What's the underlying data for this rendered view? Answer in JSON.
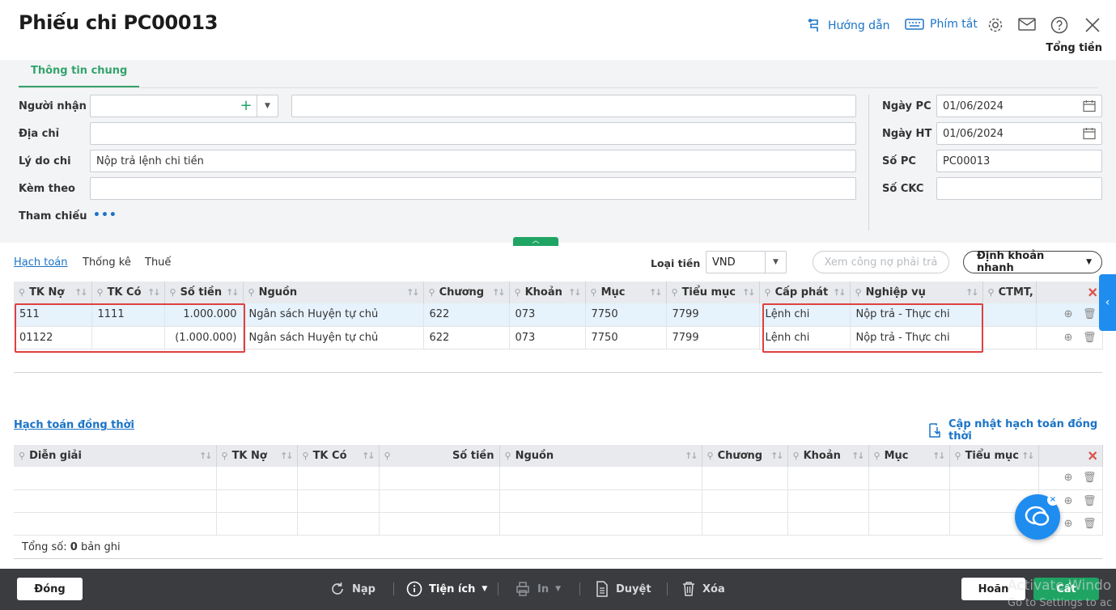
{
  "header": {
    "title": "Phiếu chi PC00013",
    "guide_label": "Hướng dẫn",
    "shortcut_label": "Phím tắt",
    "total_label": "Tổng tiền"
  },
  "tabs": {
    "general": "Thông tin chung"
  },
  "form": {
    "recipient_label": "Người nhận",
    "recipient_value": "",
    "recipient_name_value": "",
    "address_label": "Địa chỉ",
    "address_value": "",
    "reason_label": "Lý do chi",
    "reason_value": "Nộp trả lệnh chi tiền",
    "attach_label": "Kèm theo",
    "attach_value": "",
    "reference_label": "Tham chiếu",
    "reference_more": "•••",
    "date_pc_label": "Ngày PC",
    "date_pc_value": "01/06/2024",
    "date_ht_label": "Ngày HT",
    "date_ht_value": "01/06/2024",
    "so_pc_label": "Số PC",
    "so_pc_value": "PC00013",
    "so_ckc_label": "Số CKC",
    "so_ckc_value": ""
  },
  "subtabs": {
    "accounting": "Hạch toán",
    "stats": "Thống kê",
    "tax": "Thuế"
  },
  "currency": {
    "label": "Loại tiền",
    "value": "VND"
  },
  "buttons": {
    "view_debt": "Xem công nợ phải trả",
    "quick_entry": "Định khoản nhanh",
    "update_simul": "Cập nhật hạch toán đồng thời"
  },
  "accounting_table": {
    "columns": [
      "TK Nợ",
      "TK Có",
      "Số tiền",
      "Nguồn",
      "Chương",
      "Khoản",
      "Mục",
      "Tiểu mục",
      "Cấp phát",
      "Nghiệp vụ",
      "CTMT,"
    ],
    "rows": [
      {
        "tk_no": "511",
        "tk_co": "1111",
        "so_tien": "1.000.000",
        "nguon": "Ngân sách Huyện tự chủ",
        "chuong": "622",
        "khoan": "073",
        "muc": "7750",
        "tieu_muc": "7799",
        "cap_phat": "Lệnh chi",
        "nghiep_vu": "Nộp trả - Thực chi",
        "ctmt": ""
      },
      {
        "tk_no": "01122",
        "tk_co": "",
        "so_tien": "(1.000.000)",
        "nguon": "Ngân sách Huyện tự chủ",
        "chuong": "622",
        "khoan": "073",
        "muc": "7750",
        "tieu_muc": "7799",
        "cap_phat": "Lệnh chi",
        "nghiep_vu": "Nộp trả - Thực chi",
        "ctmt": ""
      }
    ]
  },
  "simul": {
    "title": "Hạch toán đồng thời",
    "columns": [
      "Diễn giải",
      "TK Nợ",
      "TK Có",
      "Số tiền",
      "Nguồn",
      "Chương",
      "Khoản",
      "Mục",
      "Tiểu mục"
    ],
    "total_prefix": "Tổng số:",
    "total_count": "0",
    "total_suffix": "bản ghi"
  },
  "footer": {
    "close": "Đóng",
    "reload": "Nạp",
    "utility": "Tiện ích",
    "print": "In",
    "approve": "Duyệt",
    "delete": "Xóa",
    "cancel": "Hoãn",
    "save": "Cất"
  },
  "watermark": {
    "line1": "Activate Windo",
    "line2": "Go to Settings to ac"
  },
  "colors": {
    "accent_green": "#33a36b",
    "link_blue": "#1b73c7",
    "highlight_red": "#e0403e",
    "footer_bg": "#3a3c40"
  }
}
